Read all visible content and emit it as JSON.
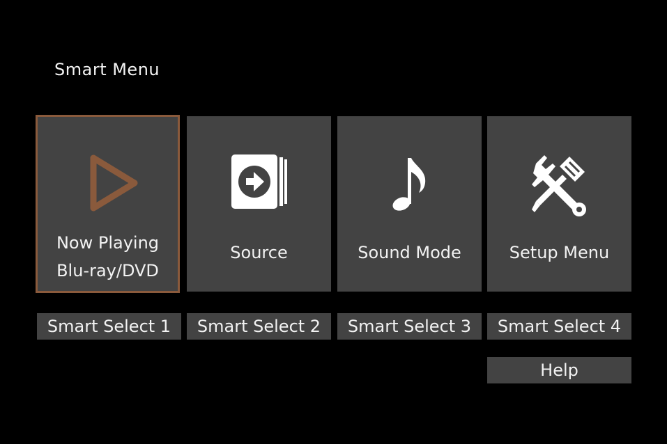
{
  "header": {
    "title": "Smart Menu"
  },
  "colors": {
    "background": "#000000",
    "tile": "#434343",
    "selected_border": "#8a5a3c",
    "text": "#f2f2f2"
  },
  "tiles": [
    {
      "icon": "play-icon",
      "label_line1": "Now Playing",
      "label_line2": "Blu-ray/DVD",
      "selected": true
    },
    {
      "icon": "source-input-icon",
      "label": "Source",
      "selected": false
    },
    {
      "icon": "music-note-icon",
      "label": "Sound Mode",
      "selected": false
    },
    {
      "icon": "wrench-screwdriver-icon",
      "label": "Setup Menu",
      "selected": false
    }
  ],
  "smart_selects": [
    {
      "label": "Smart Select 1"
    },
    {
      "label": "Smart Select 2"
    },
    {
      "label": "Smart Select 3"
    },
    {
      "label": "Smart Select 4"
    }
  ],
  "help": {
    "label": "Help"
  }
}
